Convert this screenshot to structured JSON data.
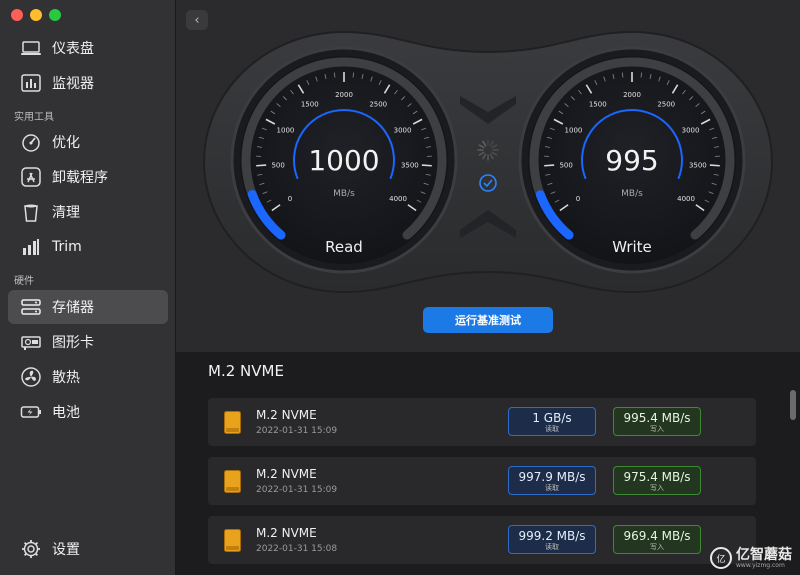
{
  "window": {
    "back_glyph": "‹"
  },
  "sidebar": {
    "items_top": [
      {
        "label": "仪表盘",
        "icon": "laptop-icon"
      },
      {
        "label": "监视器",
        "icon": "monitor-chart-icon"
      }
    ],
    "section_tools": "实用工具",
    "items_tools": [
      {
        "label": "优化",
        "icon": "gauge-icon"
      },
      {
        "label": "卸载程序",
        "icon": "app-store-icon"
      },
      {
        "label": "清理",
        "icon": "trash-icon"
      },
      {
        "label": "Trim",
        "icon": "trim-icon"
      }
    ],
    "section_hardware": "硬件",
    "items_hardware": [
      {
        "label": "存储器",
        "icon": "storage-icon",
        "active": true
      },
      {
        "label": "图形卡",
        "icon": "graphics-card-icon"
      },
      {
        "label": "散热",
        "icon": "fan-icon"
      },
      {
        "label": "电池",
        "icon": "battery-icon"
      }
    ],
    "settings": {
      "label": "设置",
      "icon": "gear-icon"
    }
  },
  "gauges": {
    "ticks": [
      "0",
      "500",
      "1000",
      "1500",
      "2000",
      "2500",
      "3000",
      "3500",
      "4000"
    ],
    "unit": "MB/s",
    "max": 4000,
    "read": {
      "value": "1000",
      "numeric": 1000,
      "label": "Read"
    },
    "write": {
      "value": "995",
      "numeric": 995,
      "label": "Write"
    }
  },
  "benchmark_button": "运行基准测试",
  "results": {
    "title": "M.2 NVME",
    "read_label": "读取",
    "write_label": "写入",
    "rows": [
      {
        "name": "M.2 NVME",
        "date": "2022-01-31 15:09",
        "read": "1 GB/s",
        "write": "995.4 MB/s"
      },
      {
        "name": "M.2 NVME",
        "date": "2022-01-31 15:09",
        "read": "997.9 MB/s",
        "write": "975.4 MB/s"
      },
      {
        "name": "M.2 NVME",
        "date": "2022-01-31 15:08",
        "read": "999.2 MB/s",
        "write": "969.4 MB/s"
      }
    ]
  },
  "watermark": {
    "brand": "亿智蘑菇",
    "url": "www.yizmg.com",
    "logo_text": "亿"
  },
  "colors": {
    "accent": "#1b7ae6",
    "gauge_arc": "#1a66ff",
    "read_border": "#2f6bc9",
    "write_border": "#3d8a34"
  }
}
